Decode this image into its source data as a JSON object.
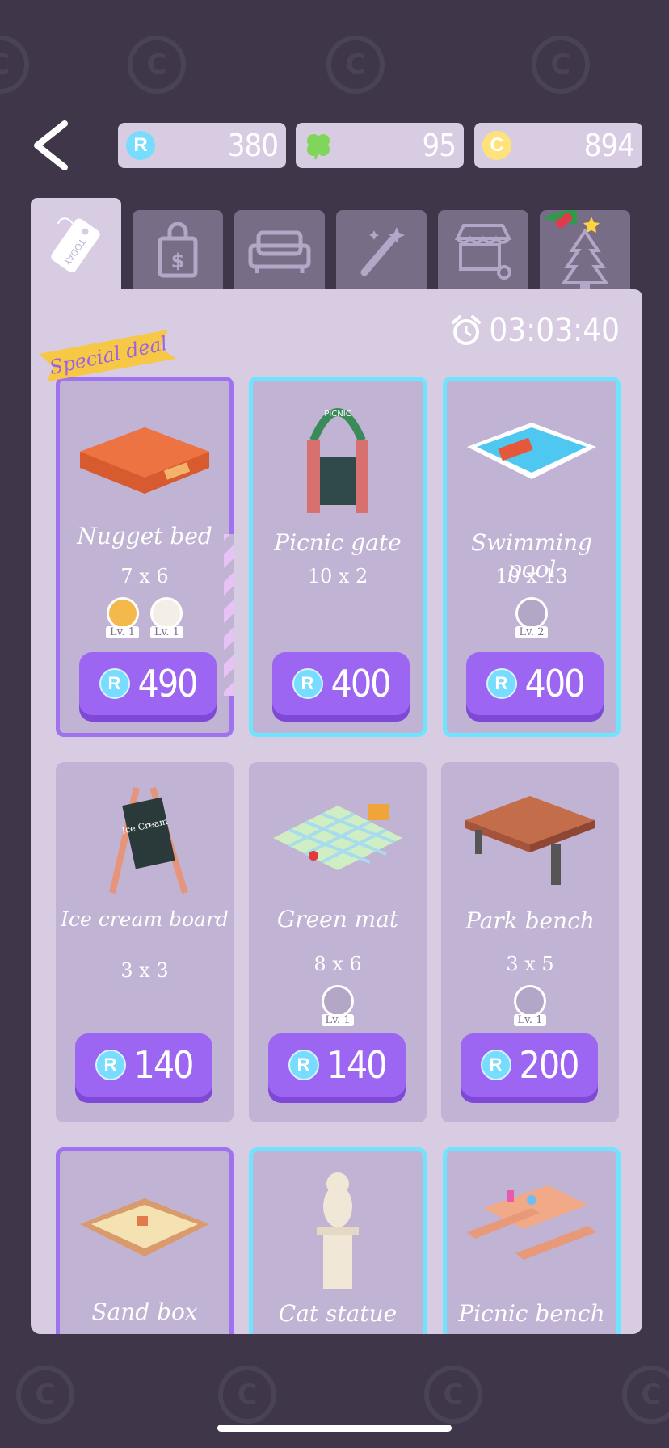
{
  "currencies": [
    {
      "icon": "ruby-coin-icon",
      "symbol": "R",
      "value": "380",
      "color": "#78dcff"
    },
    {
      "icon": "clover-icon",
      "symbol": "",
      "value": "95",
      "color": "#7fd65a"
    },
    {
      "icon": "gold-coin-icon",
      "symbol": "C",
      "value": "894",
      "color": "#ffe27a"
    }
  ],
  "tabs": [
    {
      "name": "today",
      "label": "TODAY"
    },
    {
      "name": "shop-bag",
      "label": ""
    },
    {
      "name": "furniture",
      "label": ""
    },
    {
      "name": "magic",
      "label": ""
    },
    {
      "name": "stall",
      "label": ""
    },
    {
      "name": "christmas",
      "label": ""
    }
  ],
  "timer": "03:03:40",
  "special_label": "Special deal",
  "cards": [
    {
      "name": "Nugget bed",
      "size": "7 x 6",
      "price": "490",
      "badges": [
        "Lv. 1",
        "Lv. 1"
      ],
      "border": "purple"
    },
    {
      "name": "Picnic gate",
      "size": "10 x 2",
      "price": "400",
      "badges": [],
      "border": "cyan"
    },
    {
      "name": "Swimming pool",
      "size": "10 x 13",
      "price": "400",
      "badges": [
        "Lv. 2"
      ],
      "border": "cyan"
    },
    {
      "name": "Ice cream board",
      "size": "3 x 3",
      "price": "140",
      "badges": [],
      "border": "none"
    },
    {
      "name": "Green mat",
      "size": "8 x 6",
      "price": "140",
      "badges": [
        "Lv. 1"
      ],
      "border": "none"
    },
    {
      "name": "Park bench",
      "size": "3 x 5",
      "price": "200",
      "badges": [
        "Lv. 1"
      ],
      "border": "none"
    },
    {
      "name": "Sand box",
      "size": "",
      "price": "",
      "badges": [],
      "border": "purple"
    },
    {
      "name": "Cat statue",
      "size": "",
      "price": "",
      "badges": [],
      "border": "cyan"
    },
    {
      "name": "Picnic bench",
      "size": "",
      "price": "",
      "badges": [],
      "border": "cyan"
    }
  ],
  "price_symbol": "R",
  "gate_sign": "PICNIC",
  "board_text": "Ice Cream"
}
